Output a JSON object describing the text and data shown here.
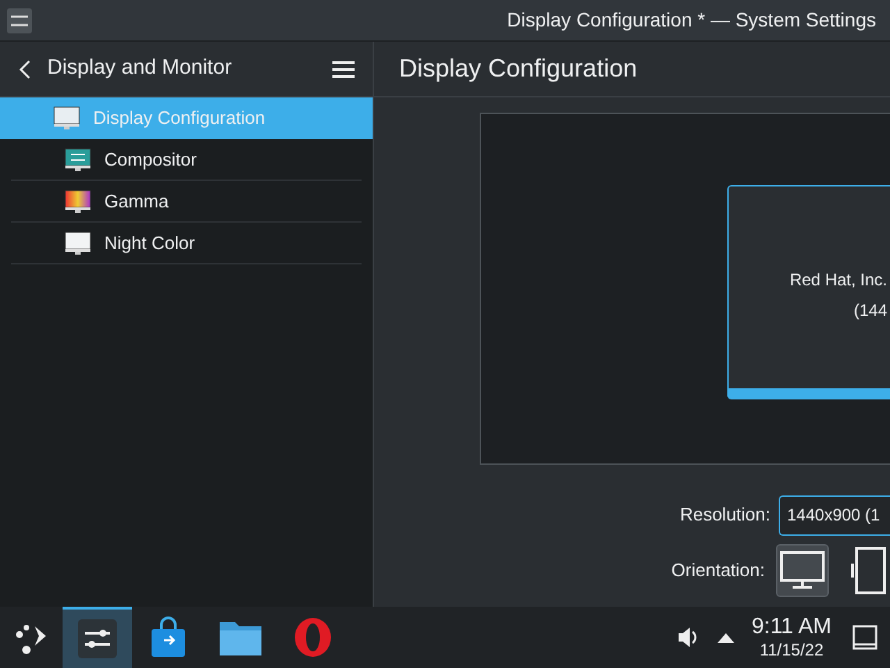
{
  "window": {
    "title": "Display Configuration * — System Settings"
  },
  "sidebar": {
    "title": "Display and Monitor",
    "items": [
      {
        "label": "Display Configuration",
        "kind": "display",
        "selected": true
      },
      {
        "label": "Compositor",
        "kind": "compositor",
        "selected": false
      },
      {
        "label": "Gamma",
        "kind": "gamma",
        "selected": false
      },
      {
        "label": "Night Color",
        "kind": "night",
        "selected": false
      }
    ]
  },
  "page": {
    "title": "Display Configuration",
    "monitor": {
      "name": "Red Hat, Inc.",
      "mode": "(144"
    },
    "resolution": {
      "label": "Resolution:",
      "value": "1440x900 (1"
    },
    "orientation": {
      "label": "Orientation:",
      "options": [
        {
          "kind": "landscape",
          "selected": true
        },
        {
          "kind": "portrait",
          "selected": false
        }
      ]
    }
  },
  "taskbar": {
    "apps": [
      {
        "kind": "settings",
        "selected": true
      },
      {
        "kind": "store",
        "selected": false
      },
      {
        "kind": "folder",
        "selected": false
      },
      {
        "kind": "browser",
        "selected": false
      }
    ],
    "clock": {
      "time": "9:11 AM",
      "date": "11/15/22"
    }
  }
}
